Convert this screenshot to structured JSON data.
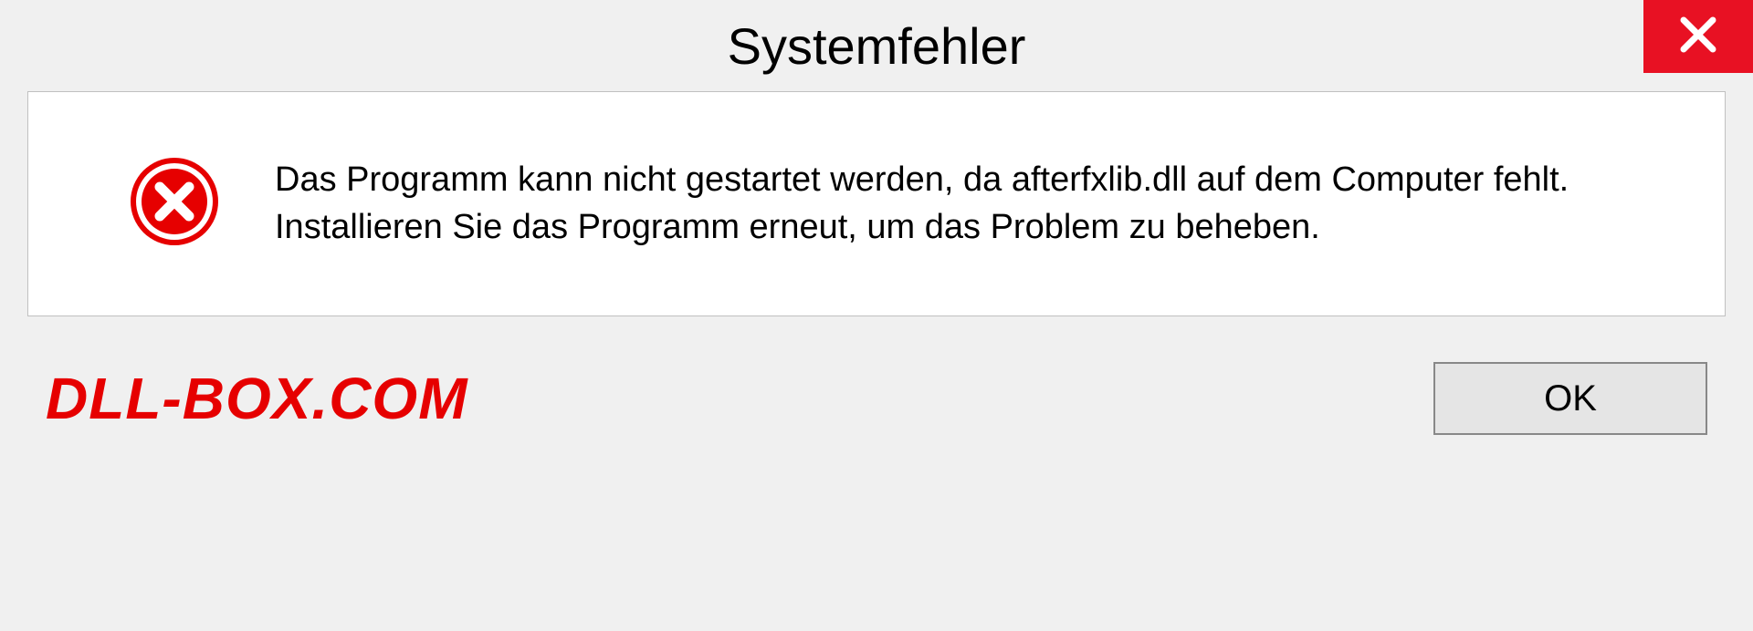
{
  "dialog": {
    "title": "Systemfehler",
    "message": "Das Programm kann nicht gestartet werden, da afterfxlib.dll auf dem Computer fehlt. Installieren Sie das Programm erneut, um das Problem zu beheben.",
    "ok_label": "OK",
    "watermark": "DLL-BOX.COM"
  },
  "colors": {
    "close_bg": "#e81123",
    "error_icon": "#e60000",
    "watermark": "#e60000"
  }
}
